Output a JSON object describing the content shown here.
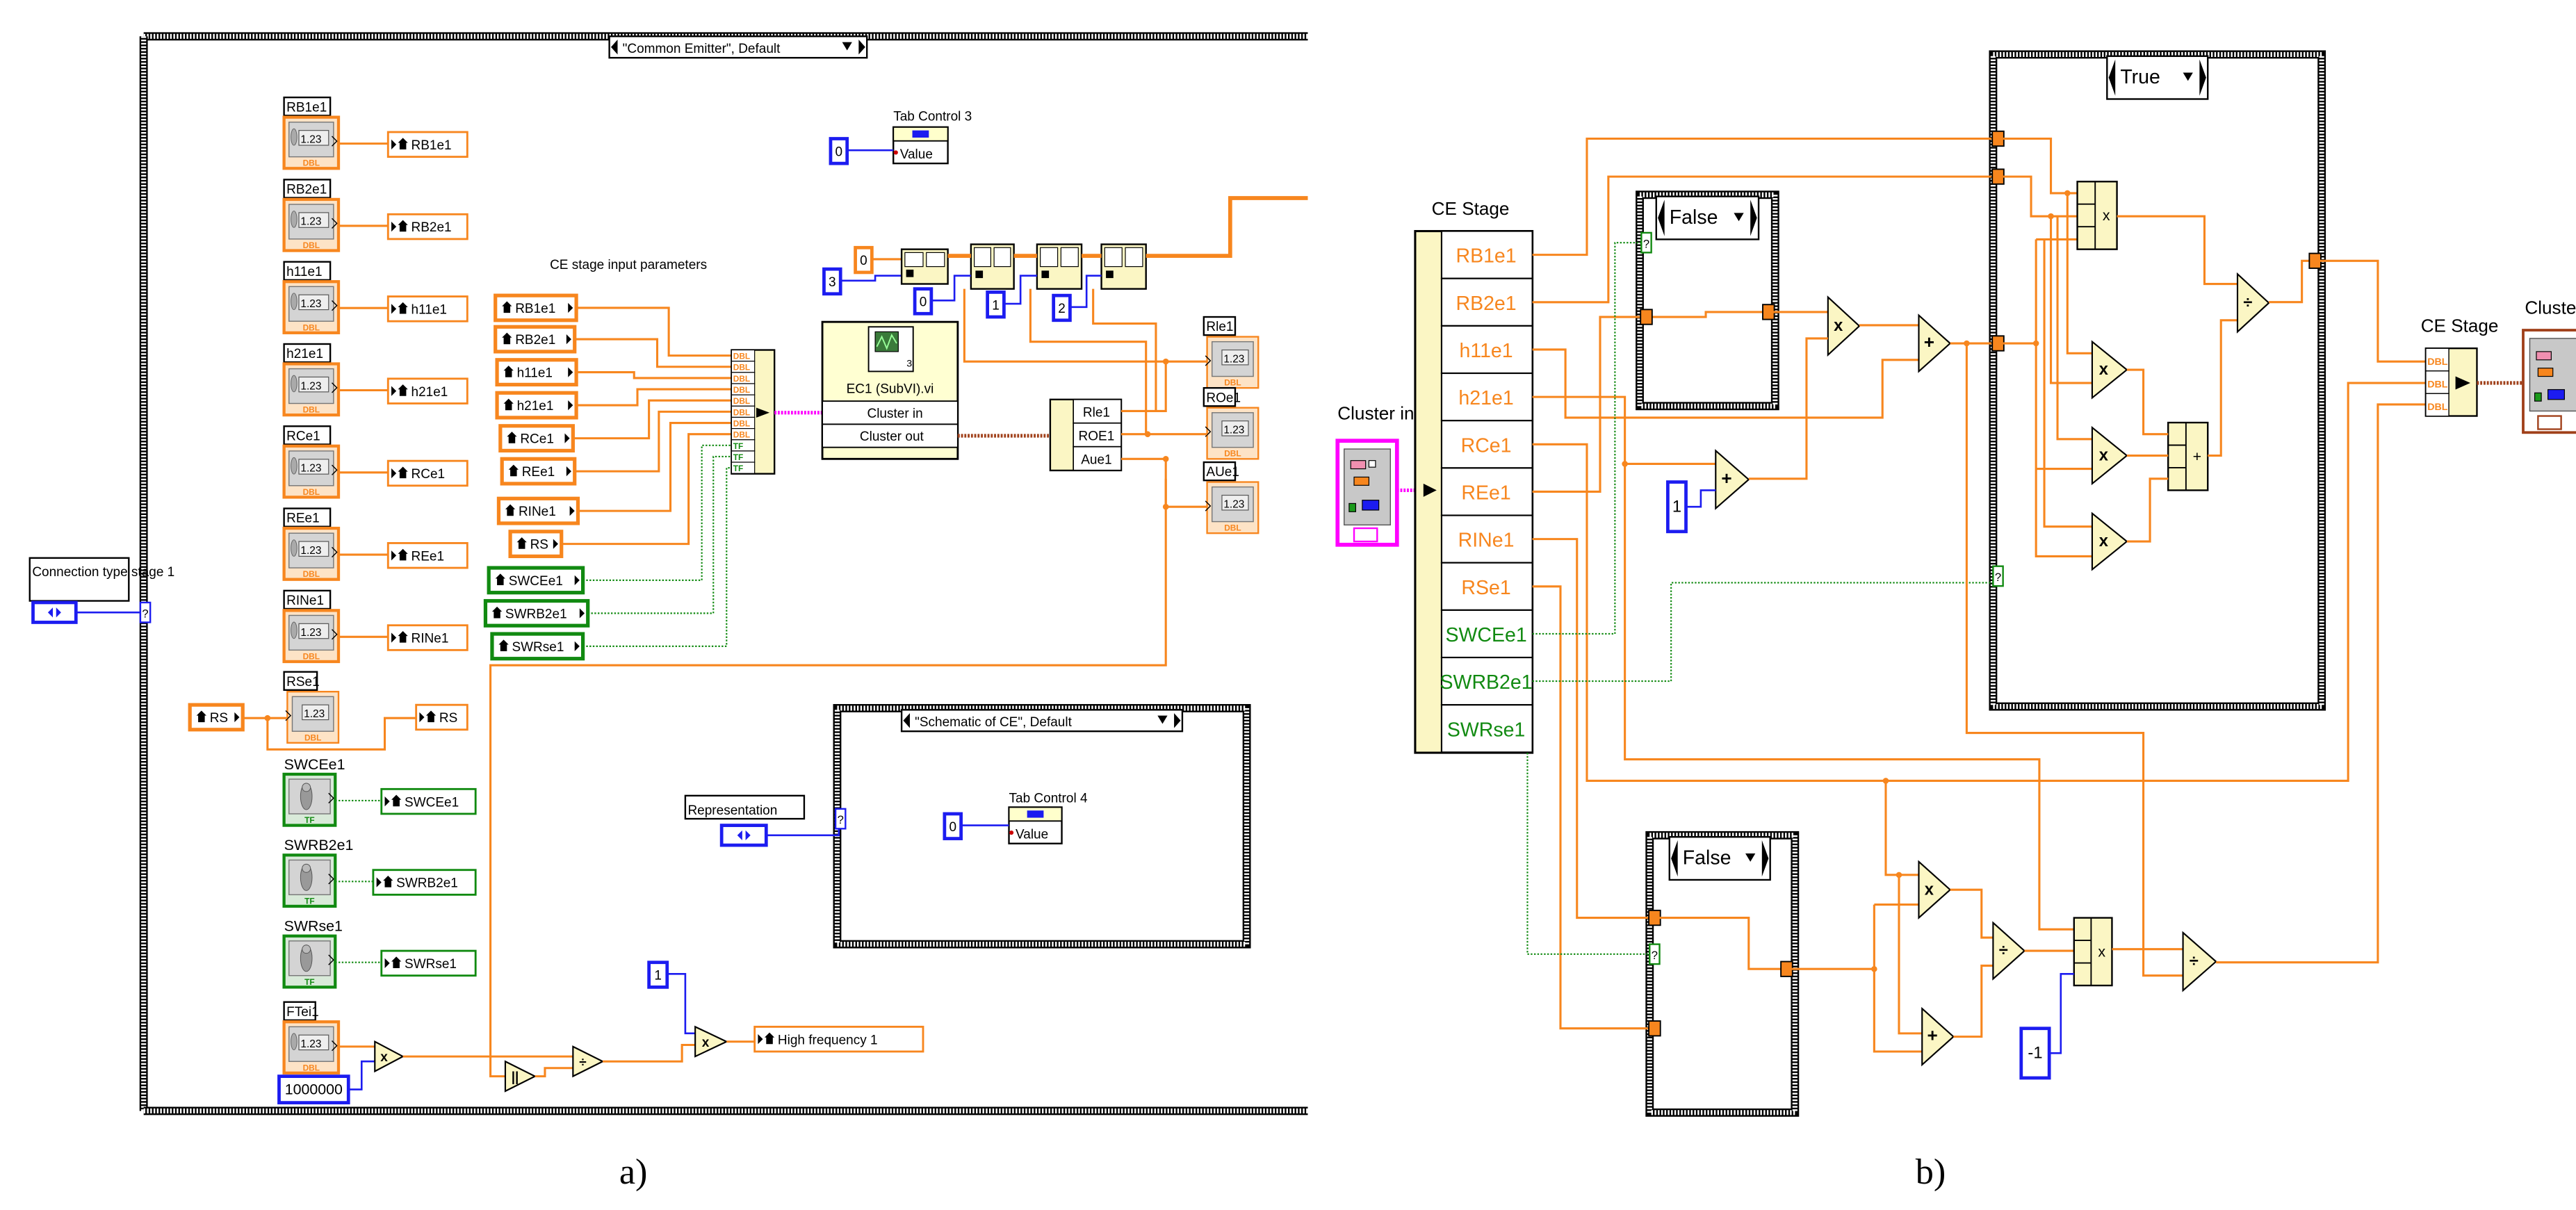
{
  "figure": {
    "label_a": "a)",
    "label_b": "b)"
  },
  "colors": {
    "numeric": "#f7861e",
    "boolean": "#118a11",
    "integer": "#1c1cf0",
    "cluster": "#ff00ff",
    "cluster_out": "#a0401a",
    "node_fill": "#fbf6c4"
  },
  "glyphs": {
    "numeric_display": "1.23",
    "dbl": "DBL",
    "tf": "TF",
    "selector": "?",
    "badge": "3"
  },
  "ops": {
    "multiply": "x",
    "add": "+",
    "divide": "÷",
    "parallel": "||"
  },
  "panel_a": {
    "case_selector": "\"Common Emitter\", Default",
    "connection_type_label": "Connection type stage 1",
    "controls": [
      {
        "label": "RB1e1",
        "local": "RB1e1"
      },
      {
        "label": "RB2e1",
        "local": "RB2e1"
      },
      {
        "label": "h11e1",
        "local": "h11e1"
      },
      {
        "label": "h21e1",
        "local": "h21e1"
      },
      {
        "label": "RCe1",
        "local": "RCe1"
      },
      {
        "label": "REe1",
        "local": "REe1"
      },
      {
        "label": "RINe1",
        "local": "RINe1"
      },
      {
        "label": "RSe1",
        "local": "RS"
      }
    ],
    "rs_input": "RS",
    "switches": [
      {
        "label": "SWCEe1",
        "local": "SWCEe1"
      },
      {
        "label": "SWRB2e1",
        "local": "SWRB2e1"
      },
      {
        "label": "SWRse1",
        "local": "SWRse1"
      }
    ],
    "frequency_control_label": "FTei1",
    "frequency_scale": "1000000",
    "section_title": "CE stage input parameters",
    "input_locals": [
      "RB1e1",
      "RB2e1",
      "h11e1",
      "h21e1",
      "RCe1",
      "REe1",
      "RINe1",
      "RS",
      "SWCEe1",
      "SWRB2e1",
      "SWRse1"
    ],
    "bundle_types": [
      "DBL",
      "DBL",
      "DBL",
      "DBL",
      "DBL",
      "DBL",
      "DBL",
      "DBL",
      "TF",
      "TF",
      "TF"
    ],
    "subvi": {
      "name": "EC1 (SubVI).vi",
      "input": "Cluster in",
      "output": "Cluster out"
    },
    "unbundle": [
      "Rle1",
      "ROE1",
      "Aue1"
    ],
    "indicators": [
      "Rle1",
      "ROe1",
      "AUe1"
    ],
    "tab_control_3": {
      "label": "Tab Control 3",
      "property": "Value",
      "constant": "0"
    },
    "array_constants": [
      "0",
      "3",
      "0",
      "1",
      "2"
    ],
    "schematic_case": {
      "selector": "\"Schematic of CE\", Default",
      "tab_label": "Tab Control 4",
      "property": "Value",
      "constant": "0"
    },
    "representation_label": "Representation",
    "constant_1": "1",
    "output_local": "High frequency 1"
  },
  "panel_b": {
    "input_label": "Cluster in",
    "unbundle_label": "CE Stage",
    "unbundle_items": [
      {
        "name": "RB1e1",
        "type": "numeric"
      },
      {
        "name": "RB2e1",
        "type": "numeric"
      },
      {
        "name": "h11e1",
        "type": "numeric"
      },
      {
        "name": "h21e1",
        "type": "numeric"
      },
      {
        "name": "RCe1",
        "type": "numeric"
      },
      {
        "name": "REe1",
        "type": "numeric"
      },
      {
        "name": "RINe1",
        "type": "numeric"
      },
      {
        "name": "RSe1",
        "type": "numeric"
      },
      {
        "name": "SWCEe1",
        "type": "boolean"
      },
      {
        "name": "SWRB2e1",
        "type": "boolean"
      },
      {
        "name": "SWRse1",
        "type": "boolean"
      }
    ],
    "case_upper": "False",
    "case_true": "True",
    "case_lower": "False",
    "constant_1": "1",
    "constant_neg1": "-1",
    "output_bundle_label": "CE Stage",
    "output_bundle_types": [
      "DBL",
      "DBL",
      "DBL"
    ],
    "output_label": "Cluster"
  }
}
